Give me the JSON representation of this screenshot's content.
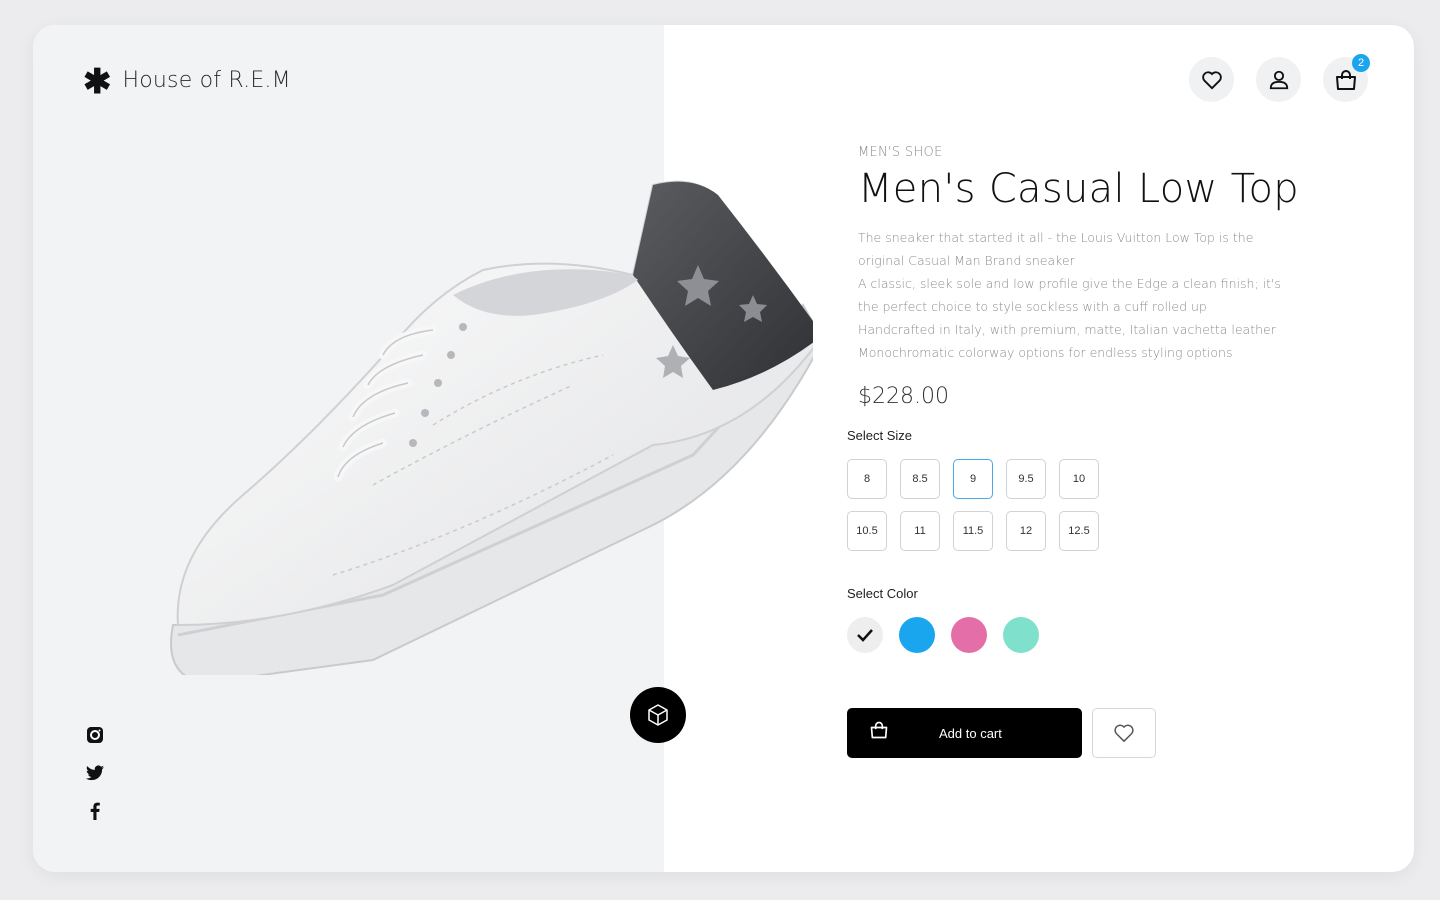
{
  "brand": {
    "symbol": "✱",
    "name": "House of R.E.M"
  },
  "header_icons": [
    "heart-icon",
    "user-icon",
    "bag-icon"
  ],
  "cart": {
    "count": "2"
  },
  "product": {
    "category": "MEN'S SHOE",
    "title": "Men's Casual Low Top",
    "description": [
      "The sneaker that started it all - the Louis Vuitton Low Top is the",
      "original Casual Man Brand sneaker",
      "A classic, sleek sole and low profile give the Edge a clean finish; it's",
      "the perfect choice to style sockless with a cuff rolled up",
      "Handcrafted in Italy, with premium, matte, Italian vachetta leather",
      "Monochromatic colorway options for endless styling options"
    ],
    "price": "$228.00"
  },
  "size_selector": {
    "label": "Select Size",
    "options": [
      "8",
      "8.5",
      "9",
      "9.5",
      "10",
      "10.5",
      "11",
      "11.5",
      "12",
      "12.5"
    ],
    "selected": "9"
  },
  "color_selector": {
    "label": "Select Color",
    "options": [
      {
        "name": "white",
        "hex": "#eeeeee",
        "selected": true
      },
      {
        "name": "blue",
        "hex": "#1aa6ee",
        "selected": false
      },
      {
        "name": "pink",
        "hex": "#e46ea8",
        "selected": false
      },
      {
        "name": "mint",
        "hex": "#7fe0cc",
        "selected": false
      }
    ]
  },
  "actions": {
    "add_to_cart": "Add to cart"
  },
  "socials": [
    "instagram-icon",
    "twitter-icon",
    "facebook-icon"
  ],
  "colors": {
    "accent": "#1aa6ee",
    "left_bg": "#f2f3f5",
    "button_bg": "#000000"
  }
}
